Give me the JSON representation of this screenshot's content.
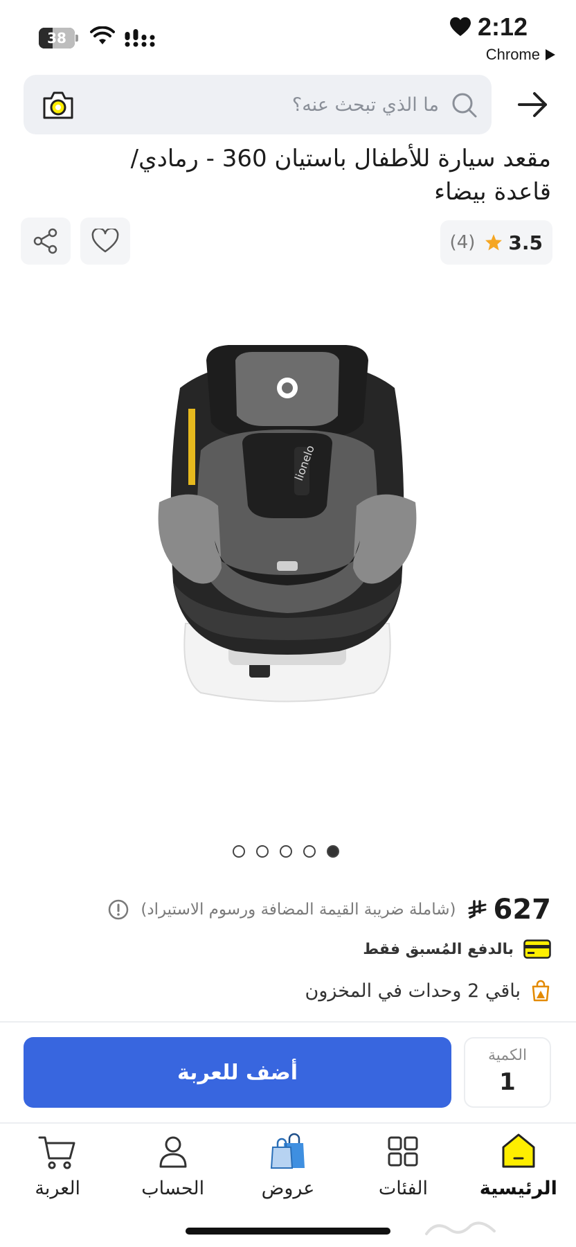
{
  "status_bar": {
    "battery": "38",
    "battery_level": 0.38,
    "time": "2:12",
    "back_app": "Chrome"
  },
  "search": {
    "placeholder": "ما الذي تبحث عنه؟"
  },
  "product": {
    "title": "مقعد سيارة للأطفال باستيان 360 - رمادي/ قاعدة بيضاء",
    "rating": "3.5",
    "rating_count": "(4)",
    "price": "627",
    "tax_note": "(شاملة ضريبة القيمة المضافة ورسوم الاستيراد)",
    "payment_note": "بالدفع المُسبق فقط",
    "stock_note": "باقي 2 وحدات في المخزون",
    "image_count": 5,
    "active_image": 0
  },
  "cart": {
    "add_label": "أضف للعربة",
    "qty_label": "الكمية",
    "qty_value": "1"
  },
  "nav": {
    "items": [
      {
        "label": "الرئيسية",
        "icon": "home-icon",
        "active": true
      },
      {
        "label": "الفئات",
        "icon": "categories-icon",
        "active": false
      },
      {
        "label": "عروض",
        "icon": "offers-bag-icon",
        "active": false
      },
      {
        "label": "الحساب",
        "icon": "account-icon",
        "active": false
      },
      {
        "label": "العربة",
        "icon": "cart-icon",
        "active": false
      }
    ]
  },
  "colors": {
    "primary": "#3866df",
    "brand_yellow": "#feee00",
    "rating_star": "#f5a623",
    "stock_orange": "#e38a00"
  }
}
